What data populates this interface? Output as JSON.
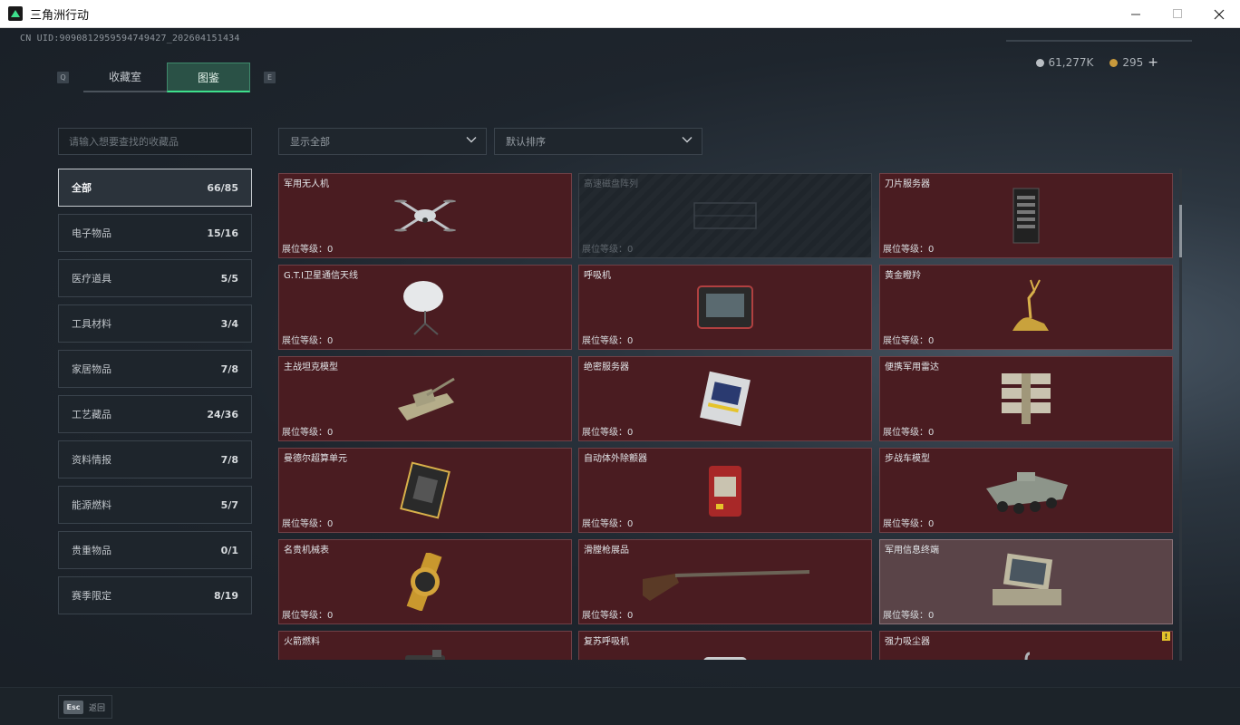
{
  "window": {
    "title": "三角洲行动"
  },
  "header": {
    "uid": "CN UID:9090812959594749427_202604151434",
    "silver_amount": "61,277K",
    "gold_amount": "295",
    "add_label": "+"
  },
  "tabs": {
    "left_key": "Q",
    "right_key": "E",
    "items": [
      {
        "label": "收藏室"
      },
      {
        "label": "图鉴"
      }
    ]
  },
  "filters": {
    "search_placeholder": "请输入想要查找的收藏品",
    "display_value": "显示全部",
    "sort_value": "默认排序"
  },
  "categories": [
    {
      "label": "全部",
      "count": "66/85"
    },
    {
      "label": "电子物品",
      "count": "15/16"
    },
    {
      "label": "医疗道具",
      "count": "5/5"
    },
    {
      "label": "工具材料",
      "count": "3/4"
    },
    {
      "label": "家居物品",
      "count": "7/8"
    },
    {
      "label": "工艺藏品",
      "count": "24/36"
    },
    {
      "label": "资料情报",
      "count": "7/8"
    },
    {
      "label": "能源燃料",
      "count": "5/7"
    },
    {
      "label": "贵重物品",
      "count": "0/1"
    },
    {
      "label": "赛季限定",
      "count": "8/19"
    }
  ],
  "items": [
    {
      "name": "军用无人机",
      "level": "展位等级：0",
      "icon": "drone-icon"
    },
    {
      "name": "高速磁盘阵列",
      "level": "展位等级：0",
      "icon": "disk-array-icon",
      "locked": true
    },
    {
      "name": "刀片服务器",
      "level": "展位等级：0",
      "icon": "blade-server-icon"
    },
    {
      "name": "G.T.I卫星通信天线",
      "level": "展位等级：0",
      "icon": "satellite-dish-icon"
    },
    {
      "name": "呼吸机",
      "level": "展位等级：0",
      "icon": "ventilator-icon"
    },
    {
      "name": "黄金瞪羚",
      "level": "展位等级：0",
      "icon": "golden-gazelle-icon"
    },
    {
      "name": "主战坦克模型",
      "level": "展位等级：0",
      "icon": "tank-model-icon"
    },
    {
      "name": "绝密服务器",
      "level": "展位等级：0",
      "icon": "secret-server-icon"
    },
    {
      "name": "便携军用雷达",
      "level": "展位等级：0",
      "icon": "radar-icon"
    },
    {
      "name": "曼德尔超算单元",
      "level": "展位等级：0",
      "icon": "supercomputer-unit-icon"
    },
    {
      "name": "自动体外除颤器",
      "level": "展位等级：0",
      "icon": "defibrillator-icon"
    },
    {
      "name": "步战车模型",
      "level": "展位等级：0",
      "icon": "ifv-model-icon"
    },
    {
      "name": "名贵机械表",
      "level": "展位等级：0",
      "icon": "watch-icon"
    },
    {
      "name": "滑膛枪展品",
      "level": "展位等级：0",
      "icon": "musket-icon"
    },
    {
      "name": "军用信息终端",
      "level": "展位等级：0",
      "icon": "terminal-icon",
      "highlight": true
    },
    {
      "name": "火箭燃料",
      "level": "",
      "icon": "fuel-can-icon"
    },
    {
      "name": "复苏呼吸机",
      "level": "",
      "icon": "resuscitator-icon"
    },
    {
      "name": "强力吸尘器",
      "level": "",
      "icon": "vacuum-icon",
      "badge": "!"
    }
  ],
  "footer": {
    "esc_key": "Esc",
    "back_label": "返回"
  },
  "colors": {
    "accent": "#3ee08c",
    "card_bg": "#4a1c21",
    "badge": "#e5c32a"
  }
}
